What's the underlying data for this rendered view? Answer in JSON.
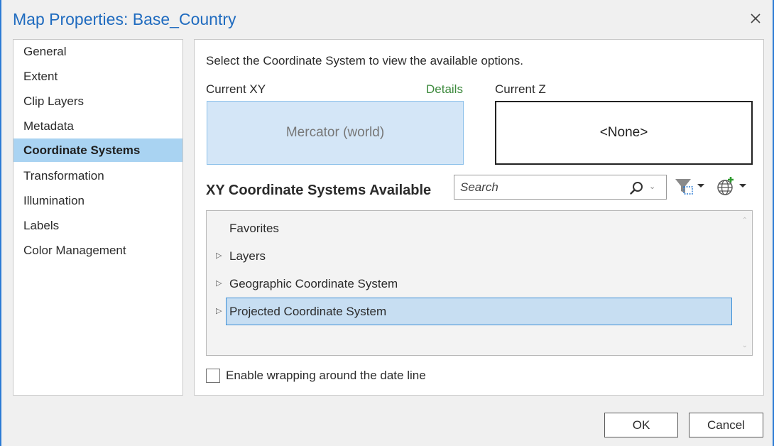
{
  "window": {
    "title": "Map Properties: Base_Country",
    "close_icon": "close-icon"
  },
  "sidebar": {
    "items": [
      {
        "label": "General"
      },
      {
        "label": "Extent"
      },
      {
        "label": "Clip Layers"
      },
      {
        "label": "Metadata"
      },
      {
        "label": "Coordinate Systems",
        "active": true
      },
      {
        "label": "Transformation"
      },
      {
        "label": "Illumination"
      },
      {
        "label": "Labels"
      },
      {
        "label": "Color Management"
      }
    ]
  },
  "main": {
    "instruction": "Select the Coordinate System to view the available options.",
    "current_xy": {
      "label": "Current XY",
      "details_link": "Details",
      "value": "Mercator (world)"
    },
    "current_z": {
      "label": "Current Z",
      "value": "<None>"
    },
    "section_title": "XY Coordinate Systems Available",
    "search": {
      "placeholder": "Search",
      "icon": "search-icon"
    },
    "toolbar": {
      "filter_icon": "filter-icon",
      "globe_icon": "globe-add-icon"
    },
    "tree": {
      "items": [
        {
          "label": "Favorites",
          "expandable": false
        },
        {
          "label": "Layers",
          "expandable": true
        },
        {
          "label": "Geographic Coordinate System",
          "expandable": true
        },
        {
          "label": "Projected Coordinate System",
          "expandable": true,
          "selected": true
        }
      ]
    },
    "wrap_checkbox": {
      "label": "Enable wrapping around the date line",
      "checked": false
    }
  },
  "footer": {
    "ok_label": "OK",
    "cancel_label": "Cancel"
  },
  "colors": {
    "accent": "#1f6bbf",
    "selection": "#a9d3f2",
    "link": "#3d8a3d"
  }
}
